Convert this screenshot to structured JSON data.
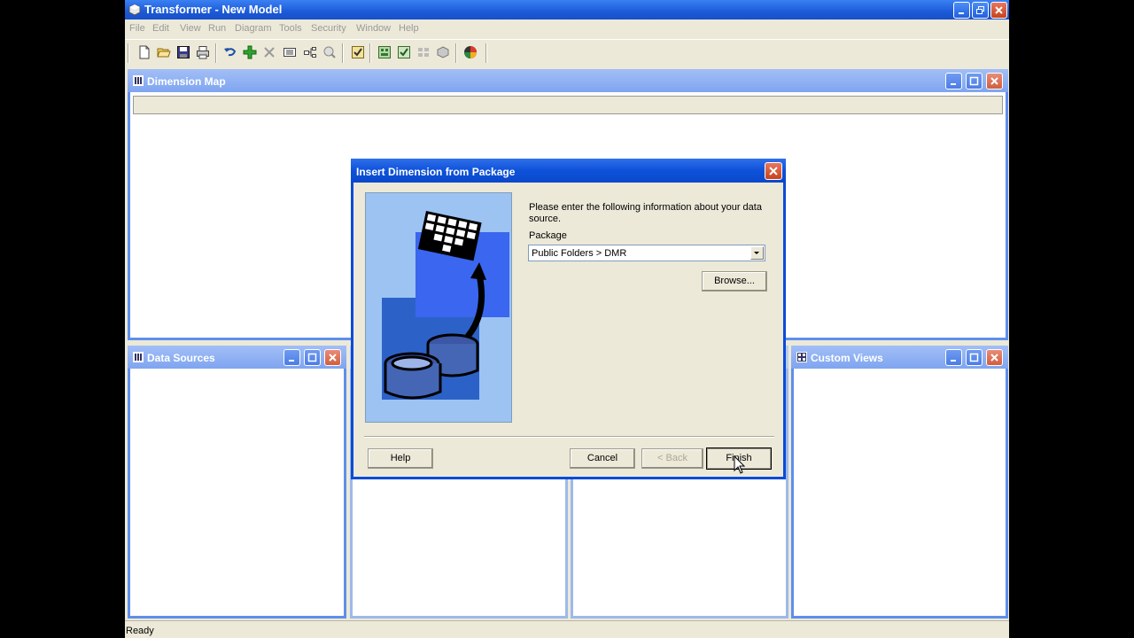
{
  "app": {
    "title": "Transformer - New Model",
    "menu": [
      "File",
      "Edit",
      "View",
      "Run",
      "Diagram",
      "Tools",
      "Security",
      "Window",
      "Help"
    ],
    "status": "Ready"
  },
  "toolbar": {
    "icons": [
      "new-icon",
      "open-icon",
      "save-icon",
      "print-icon",
      "undo-icon",
      "add-icon",
      "delete-icon",
      "properties-icon",
      "diagram-icon",
      "explore-icon",
      "check-model-icon",
      "generate-cubes-icon",
      "verify-icon",
      "cube-icon",
      "cognos-icon"
    ]
  },
  "panels": {
    "dimension_map": {
      "title": "Dimension Map"
    },
    "data_sources": {
      "title": "Data Sources"
    },
    "custom_views": {
      "title": "Custom Views"
    }
  },
  "dialog": {
    "title": "Insert Dimension from Package",
    "prompt": "Please enter the following information about your data source.",
    "package_label": "Package",
    "package_value": "Public Folders > DMR",
    "buttons": {
      "browse": "Browse...",
      "help": "Help",
      "cancel": "Cancel",
      "back": "< Back",
      "finish": "Finish"
    }
  }
}
